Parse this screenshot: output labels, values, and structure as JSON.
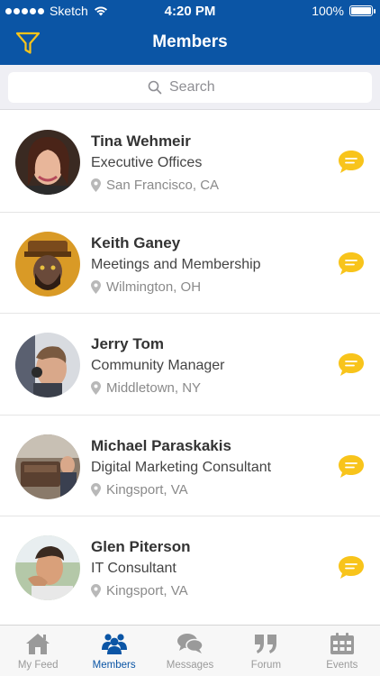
{
  "status_bar": {
    "carrier": "Sketch",
    "time": "4:20 PM",
    "battery": "100%"
  },
  "nav": {
    "title": "Members",
    "filter_icon": "filter-icon"
  },
  "search": {
    "placeholder": "Search"
  },
  "members": [
    {
      "name": "Tina Wehmeir",
      "role": "Executive Offices",
      "location": "San Francisco, CA"
    },
    {
      "name": "Keith Ganey",
      "role": "Meetings and Membership",
      "location": "Wilmington, OH"
    },
    {
      "name": "Jerry Tom",
      "role": "Community Manager",
      "location": "Middletown, NY"
    },
    {
      "name": "Michael Paraskakis",
      "role": "Digital Marketing Consultant",
      "location": "Kingsport, VA"
    },
    {
      "name": "Glen Piterson",
      "role": "IT Consultant",
      "location": "Kingsport, VA"
    }
  ],
  "tabs": [
    {
      "label": "My Feed",
      "icon": "home-icon",
      "active": false
    },
    {
      "label": "Members",
      "icon": "members-icon",
      "active": true
    },
    {
      "label": "Messages",
      "icon": "messages-icon",
      "active": false
    },
    {
      "label": "Forum",
      "icon": "quote-icon",
      "active": false
    },
    {
      "label": "Events",
      "icon": "calendar-icon",
      "active": false
    }
  ],
  "colors": {
    "brand": "#0b55a5",
    "accent": "#f8c41b",
    "tab_inactive": "#9a9a9a"
  }
}
